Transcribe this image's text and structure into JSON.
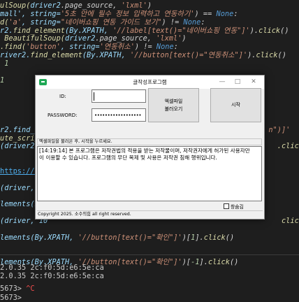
{
  "code_lines": [
    {
      "segments": [
        {
          "t": "ulSoup(",
          "c": "c-fn"
        },
        {
          "t": "driver2",
          "c": "c-var"
        },
        {
          "t": ".page_source, ",
          "c": "c-pl"
        },
        {
          "t": "'lxml'",
          "c": "c-str"
        },
        {
          "t": ")",
          "c": "c-pl"
        }
      ]
    },
    {
      "segments": [
        {
          "t": "mall', string=",
          "c": "c-var"
        },
        {
          "t": "'5초 안에 필수 정보 입력하고 연동하기'",
          "c": "c-str"
        },
        {
          "t": ") == ",
          "c": "c-pl"
        },
        {
          "t": "None",
          "c": "c-kw"
        },
        {
          "t": ":",
          "c": "c-pl"
        }
      ]
    },
    {
      "segments": [
        {
          "t": "d(",
          "c": "c-fn"
        },
        {
          "t": "'a'",
          "c": "c-str"
        },
        {
          "t": ", string=",
          "c": "c-var"
        },
        {
          "t": "\"네이버쇼핑 연동 가이드 보기\"",
          "c": "c-str"
        },
        {
          "t": ") != ",
          "c": "c-pl"
        },
        {
          "t": "None",
          "c": "c-kw"
        },
        {
          "t": ":",
          "c": "c-pl"
        }
      ]
    },
    {
      "segments": [
        {
          "t": "r2.",
          "c": "c-var"
        },
        {
          "t": "find_element",
          "c": "c-fn"
        },
        {
          "t": "(By.XPATH, ",
          "c": "c-var"
        },
        {
          "t": "'//label[text()=\"네이버쇼핑 연동\"]'",
          "c": "c-str"
        },
        {
          "t": ").",
          "c": "c-pl"
        },
        {
          "t": "click",
          "c": "c-fn"
        },
        {
          "t": "()",
          "c": "c-pl"
        }
      ]
    },
    {
      "segments": [
        {
          "t": " BeautifulSoup(",
          "c": "c-fn"
        },
        {
          "t": "driver2",
          "c": "c-var"
        },
        {
          "t": ".page_source, ",
          "c": "c-pl"
        },
        {
          "t": "'lxml'",
          "c": "c-str"
        },
        {
          "t": ")",
          "c": "c-pl"
        }
      ]
    },
    {
      "segments": [
        {
          "t": ".find(",
          "c": "c-fn"
        },
        {
          "t": "'button'",
          "c": "c-str"
        },
        {
          "t": ", string=",
          "c": "c-var"
        },
        {
          "t": "'연동취소'",
          "c": "c-str"
        },
        {
          "t": ") != ",
          "c": "c-pl"
        },
        {
          "t": "None",
          "c": "c-kw"
        },
        {
          "t": ":",
          "c": "c-pl"
        }
      ]
    },
    {
      "segments": [
        {
          "t": "river2.",
          "c": "c-var"
        },
        {
          "t": "find_element",
          "c": "c-fn"
        },
        {
          "t": "(By.XPATH, ",
          "c": "c-var"
        },
        {
          "t": "'//button[text()=\"연동취소\"]'",
          "c": "c-str"
        },
        {
          "t": ").",
          "c": "c-pl"
        },
        {
          "t": "click",
          "c": "c-fn"
        },
        {
          "t": "()",
          "c": "c-pl"
        }
      ]
    },
    {
      "segments": [
        {
          "t": " 1",
          "c": "c-num"
        }
      ]
    },
    {
      "segments": []
    },
    {
      "segments": [
        {
          "t": "1",
          "c": "c-num"
        }
      ]
    },
    {
      "segments": []
    },
    {
      "segments": []
    },
    {
      "segments": []
    },
    {
      "segments": []
    },
    {
      "segments": []
    },
    {
      "segments": [
        {
          "t": "r2.find_e",
          "c": "c-var"
        },
        {
          "t": "                                                     ",
          "c": "c-pl"
        },
        {
          "t": "n\")]'",
          "c": "c-str"
        }
      ]
    },
    {
      "segments": [
        {
          "t": "ute_script(",
          "c": "c-fn"
        }
      ]
    },
    {
      "segments": [
        {
          "t": "(driver2, 1",
          "c": "c-var"
        },
        {
          "t": "                                                     ",
          "c": "c-pl"
        },
        {
          "t": ".click()",
          "c": "c-fn"
        }
      ]
    },
    {
      "segments": []
    },
    {
      "segments": []
    },
    {
      "segments": [
        {
          "t": "https://m.bu",
          "c": "c-link"
        }
      ]
    },
    {
      "segments": []
    },
    {
      "segments": [
        {
          "t": "(driver, 10",
          "c": "c-var"
        }
      ]
    },
    {
      "segments": []
    },
    {
      "segments": [
        {
          "t": "lements(By.X",
          "c": "c-var"
        }
      ]
    },
    {
      "segments": []
    },
    {
      "segments": [
        {
          "t": "(driver, 10",
          "c": "c-var"
        },
        {
          "t": "                                                      ",
          "c": "c-pl"
        },
        {
          "t": "click()",
          "c": "c-fn"
        }
      ]
    },
    {
      "segments": []
    },
    {
      "segments": [
        {
          "t": "lements(By.XPATH, ",
          "c": "c-var"
        },
        {
          "t": "'//button[text()=\"확인\"]'",
          "c": "c-str"
        },
        {
          "t": ")[",
          "c": "c-pl"
        },
        {
          "t": "1",
          "c": "c-num"
        },
        {
          "t": "].",
          "c": "c-pl"
        },
        {
          "t": "click",
          "c": "c-fn"
        },
        {
          "t": "()",
          "c": "c-pl"
        }
      ]
    },
    {
      "segments": []
    },
    {
      "segments": []
    },
    {
      "segments": [
        {
          "t": "lements(By.XPATH, ",
          "c": "c-var"
        },
        {
          "t": "'//button[text()=\"확인\"]'",
          "c": "c-str"
        },
        {
          "t": ")[",
          "c": "c-pl"
        },
        {
          "t": "-1",
          "c": "c-num"
        },
        {
          "t": "].",
          "c": "c-pl"
        },
        {
          "t": "click",
          "c": "c-fn"
        },
        {
          "t": "()",
          "c": "c-pl"
        }
      ]
    }
  ],
  "terminal": {
    "line1": "2.0.35 2c:f0:5d:e6:5e:ca",
    "line2": "2.0.35 2c:f0:5d:e6:5e:ca",
    "prompt_prefix": "5673> ",
    "prompt_interrupt": "^C",
    "prompt2": "5673> "
  },
  "dialog": {
    "title": "글작성프로그램",
    "window_buttons": {
      "minimize": "—",
      "maximize": "□",
      "close": "✕"
    },
    "id_label": "ID:",
    "id_value": "",
    "password_label": "PASSWORD:",
    "password_mask": "••••••••••••••••••",
    "excel_button": "엑셀파일\n불러오기",
    "start_button": "시작",
    "status_text": "엑셀파일을 불러온 후, 시작을 누르세요.",
    "log_text": "[14:19:14] 본 프로그램은 저작권법의 적용을 받는 저작물이며, 저작권자에게 허가된 사용자만이 이용할 수 있습니다. 프로그램의 무단 복제 및 사용은 저작권 침해 행위입니다.",
    "checkbox_label": "창숨김",
    "checkbox_checked": false,
    "footer": "Copyright 2025. 소수의힘 all right reserved."
  }
}
